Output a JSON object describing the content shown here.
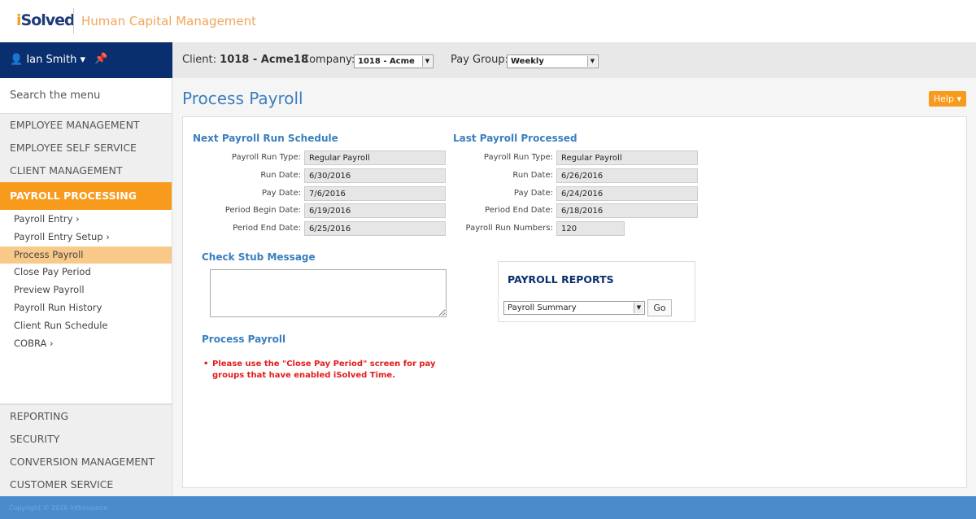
{
  "header": {
    "logo": "iSolved",
    "tagline": "Human Capital Management"
  },
  "user": {
    "name": "Ian Smith"
  },
  "topbar": {
    "client_label": "Client:",
    "client_value": "1018 - Acme18",
    "company_label": "Company:",
    "company_value": "1018 - Acme",
    "paygroup_label": "Pay Group:",
    "paygroup_value": "Weekly"
  },
  "sidebar": {
    "search_placeholder": "Search the menu",
    "top_items": [
      "EMPLOYEE MANAGEMENT",
      "EMPLOYEE SELF SERVICE",
      "CLIENT MANAGEMENT"
    ],
    "active": "PAYROLL PROCESSING",
    "sub_items": [
      "Payroll Entry  ›",
      "Payroll Entry Setup  ›",
      "Process Payroll",
      "Close Pay Period",
      "Preview Payroll",
      "Payroll Run History",
      "Client Run Schedule",
      "COBRA  ›"
    ],
    "bottom_items": [
      "REPORTING",
      "SECURITY",
      "CONVERSION MANAGEMENT",
      "CUSTOMER SERVICE"
    ]
  },
  "page": {
    "title": "Process Payroll",
    "help": "Help ▾",
    "next": {
      "heading": "Next Payroll Run Schedule",
      "fields": [
        [
          "Payroll Run Type:",
          "Regular Payroll"
        ],
        [
          "Run Date:",
          "6/30/2016"
        ],
        [
          "Pay Date:",
          "7/6/2016"
        ],
        [
          "Period Begin Date:",
          "6/19/2016"
        ],
        [
          "Period End Date:",
          "6/25/2016"
        ]
      ]
    },
    "last": {
      "heading": "Last Payroll Processed",
      "fields": [
        [
          "Payroll Run Type:",
          "Regular Payroll"
        ],
        [
          "Run Date:",
          "6/26/2016"
        ],
        [
          "Pay Date:",
          "6/24/2016"
        ],
        [
          "Period End Date:",
          "6/18/2016"
        ],
        [
          "Payroll Run Numbers:",
          "120"
        ]
      ]
    },
    "check_stub": "Check Stub Message",
    "process_heading": "Process Payroll",
    "message": "Please use the \"Close Pay Period\" screen for pay groups that have enabled iSolved Time.",
    "reports": {
      "heading": "PAYROLL REPORTS",
      "selected": "Payroll Summary",
      "go": "Go"
    }
  },
  "footer": "Copyright © 2016 Infinisource"
}
